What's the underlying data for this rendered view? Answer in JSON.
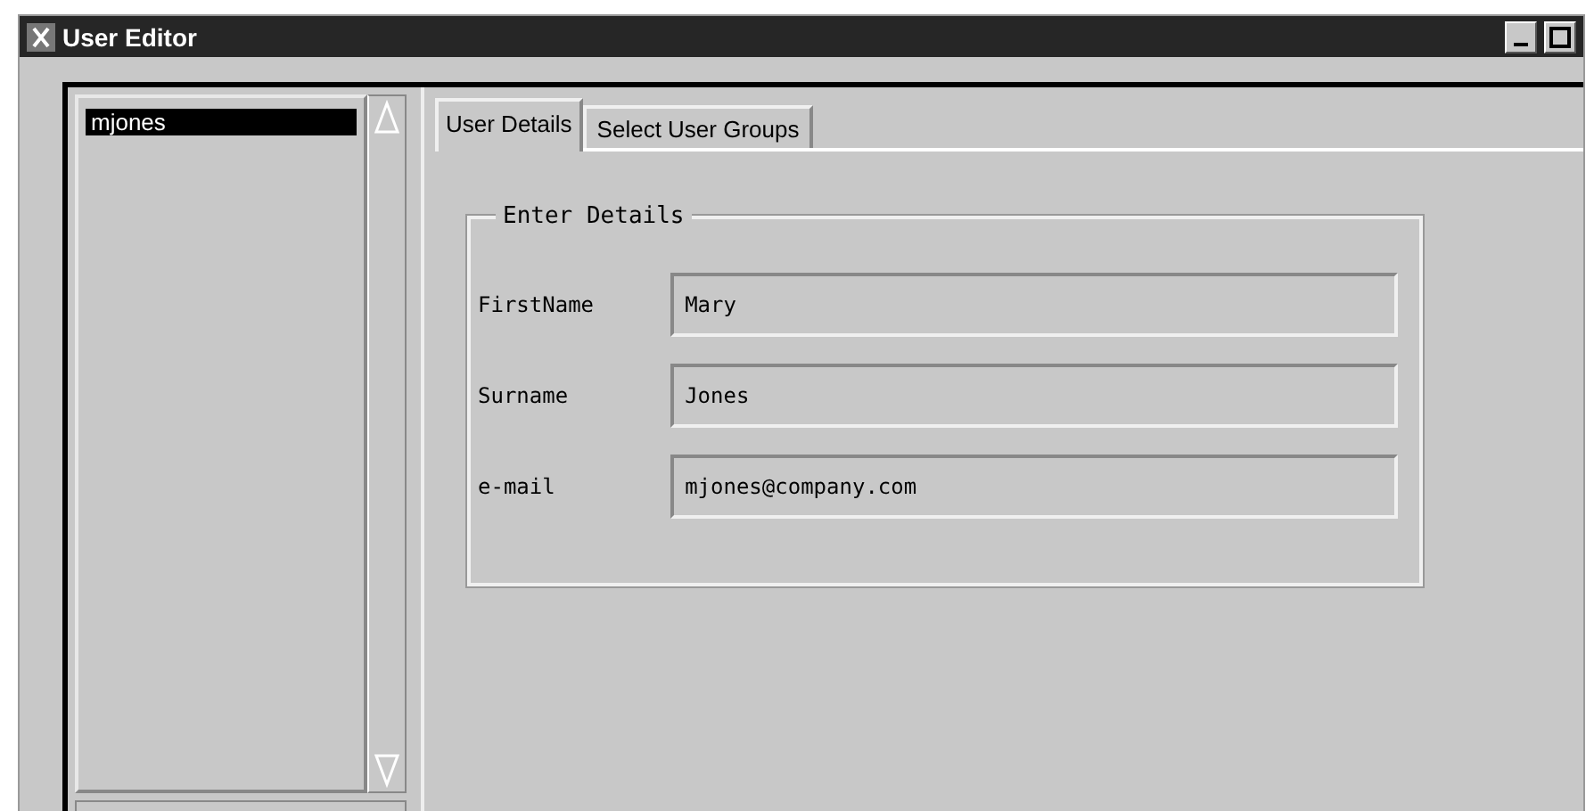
{
  "window": {
    "title": "User Editor"
  },
  "user_list": {
    "items": [
      {
        "label": "mjones",
        "selected": true
      }
    ]
  },
  "tabs": [
    {
      "label": "User Details",
      "selected": true
    },
    {
      "label": "Select User Groups",
      "selected": false
    }
  ],
  "group": {
    "title": "Enter Details",
    "fields": [
      {
        "label": "FirstName",
        "value": "Mary"
      },
      {
        "label": "Surname",
        "value": "Jones"
      },
      {
        "label": "e-mail",
        "value": "mjones@company.com"
      }
    ]
  }
}
